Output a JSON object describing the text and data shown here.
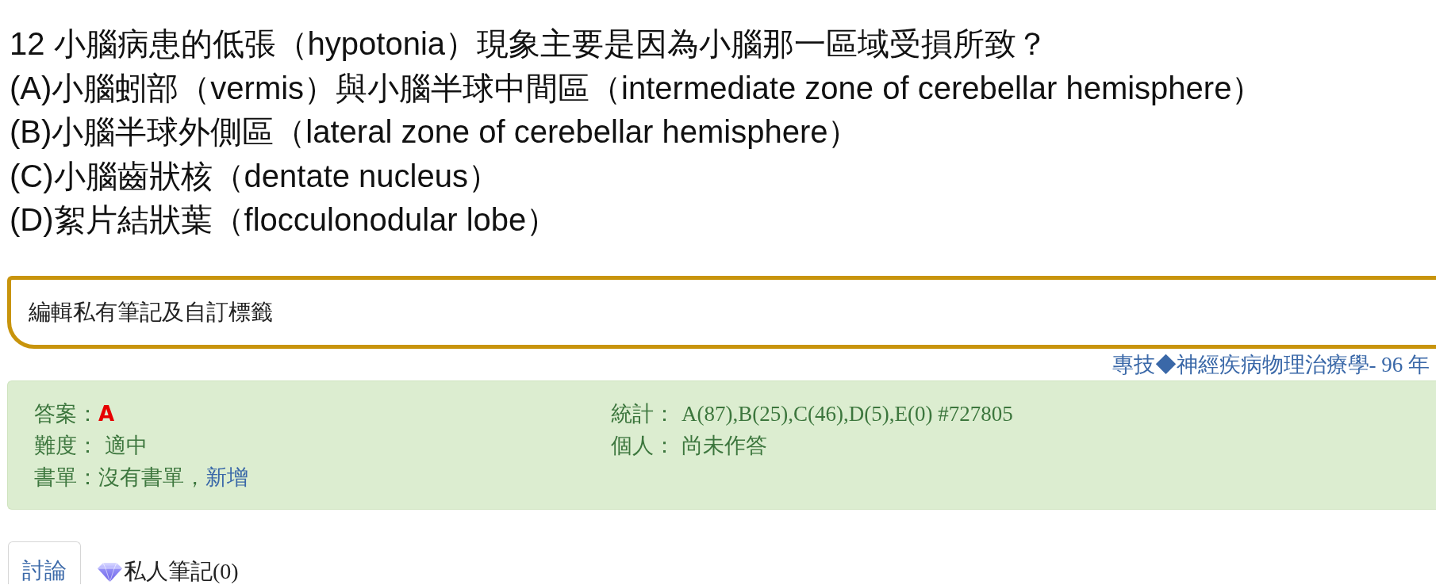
{
  "question": {
    "text": "12 小腦病患的低張（hypotonia）現象主要是因為小腦那一區域受損所致？",
    "options": [
      "(A)小腦蚓部（vermis）與小腦半球中間區（intermediate zone of cerebellar hemisphere）",
      "(B)小腦半球外側區（lateral zone of cerebellar hemisphere）",
      "(C)小腦齒狀核（dentate nucleus）",
      "(D)絮片結狀葉（flocculonodular lobe）"
    ]
  },
  "note_editor": {
    "label": "編輯私有筆記及自訂標籤"
  },
  "source": {
    "label": "專技◆神經疾病物理治療學- 96 年"
  },
  "info_panel": {
    "left": [
      {
        "kind": "answer",
        "label": "答案：",
        "value": "A"
      },
      {
        "kind": "text",
        "label": "難度：",
        "value": "適中"
      },
      {
        "kind": "link",
        "label": "書單：",
        "value": "沒有書單，",
        "link": "新增"
      }
    ],
    "right": [
      {
        "kind": "text",
        "label": "統計：",
        "value": "A(87),B(25),C(46),D(5),E(0) #727805"
      },
      {
        "kind": "text",
        "label": "個人：",
        "value": "尚未作答"
      }
    ]
  },
  "tabs": [
    {
      "kind": "plain",
      "label": "討論",
      "selected": true
    },
    {
      "kind": "iconed",
      "label": "私人筆記(0)",
      "selected": false
    }
  ]
}
